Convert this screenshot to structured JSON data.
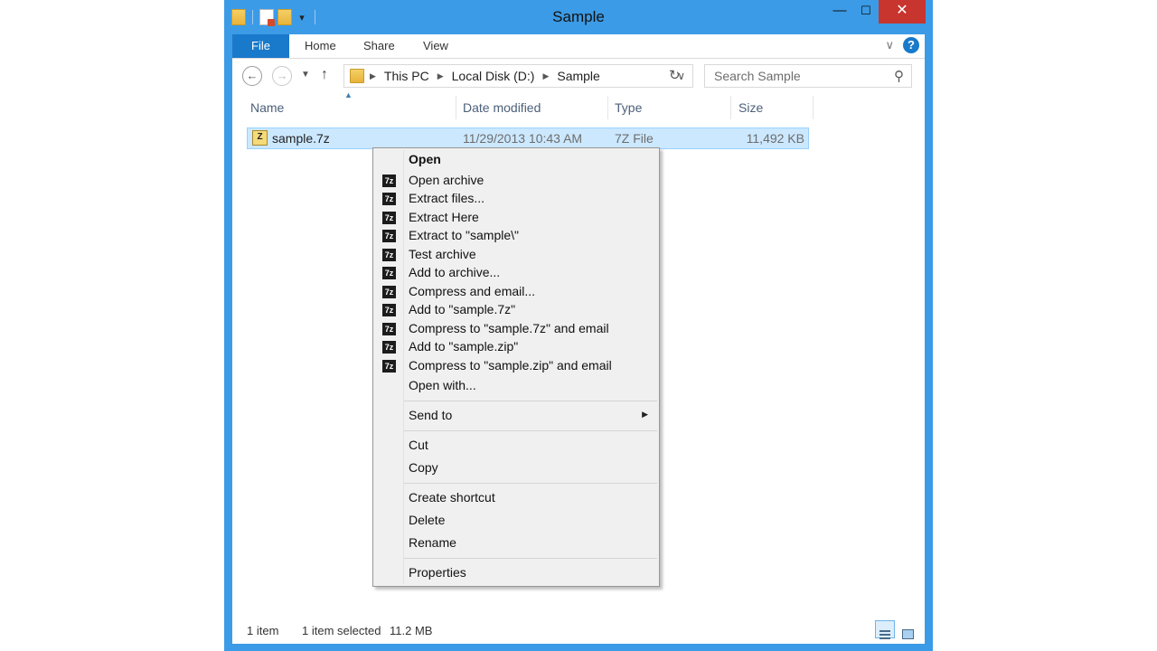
{
  "window": {
    "title": "Sample",
    "close_glyph": "✕",
    "minimize_glyph": "—",
    "maximize_glyph": "☐"
  },
  "ribbon": {
    "tabs": [
      "File",
      "Home",
      "Share",
      "View"
    ],
    "help": "?"
  },
  "nav": {
    "breadcrumbs": [
      "This PC",
      "Local Disk (D:)",
      "Sample"
    ],
    "search_placeholder": "Search Sample"
  },
  "columns": {
    "name": "Name",
    "date": "Date modified",
    "type": "Type",
    "size": "Size"
  },
  "files": [
    {
      "name": "sample.7z",
      "date": "11/29/2013 10:43 AM",
      "type": "7Z File",
      "size": "11,492 KB"
    }
  ],
  "context_menu": {
    "items": [
      {
        "label": "Open",
        "bold": true,
        "icon": ""
      },
      {
        "label": "Open archive",
        "icon": "7z-icon"
      },
      {
        "label": "Extract files...",
        "icon": "7z-icon"
      },
      {
        "label": "Extract Here",
        "icon": "7z-icon"
      },
      {
        "label": "Extract to \"sample\\\"",
        "icon": "7z-icon"
      },
      {
        "label": "Test archive",
        "icon": "7z-icon"
      },
      {
        "label": "Add to archive...",
        "icon": "7z-icon"
      },
      {
        "label": "Compress and email...",
        "icon": "7z-icon"
      },
      {
        "label": "Add to \"sample.7z\"",
        "icon": "7z-icon"
      },
      {
        "label": "Compress to \"sample.7z\" and email",
        "icon": "7z-icon"
      },
      {
        "label": "Add to \"sample.zip\"",
        "icon": "7z-icon"
      },
      {
        "label": "Compress to \"sample.zip\" and email",
        "icon": "7z-icon"
      },
      {
        "label": "Open with...",
        "icon": ""
      },
      {
        "label": "Send to",
        "icon": "",
        "submenu": true
      },
      {
        "label": "Cut",
        "icon": ""
      },
      {
        "label": "Copy",
        "icon": ""
      },
      {
        "label": "Create shortcut",
        "icon": ""
      },
      {
        "label": "Delete",
        "icon": ""
      },
      {
        "label": "Rename",
        "icon": ""
      },
      {
        "label": "Properties",
        "icon": ""
      }
    ],
    "icon_text": "7z"
  },
  "status": {
    "count": "1 item",
    "selected": "1 item selected",
    "size": "11.2 MB"
  },
  "colors": {
    "frame": "#3c9be6",
    "file_tab": "#1979ca",
    "close": "#c7352e",
    "selection": "#cce8ff"
  }
}
